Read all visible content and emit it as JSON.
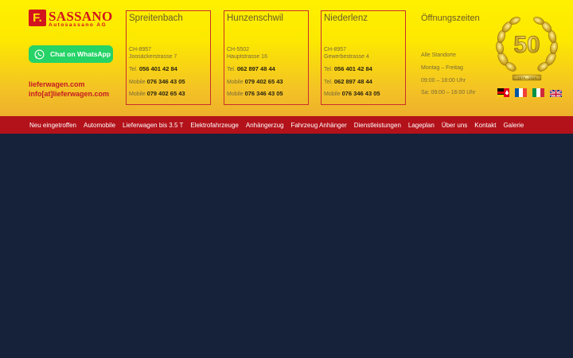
{
  "logo": {
    "box_letter": "F.",
    "name": "SASSANO",
    "sub": "Autosassano AG"
  },
  "whatsapp": {
    "label": "Chat on WhatsApp"
  },
  "links": {
    "website": "lieferwagen.com",
    "email": "info[at]lieferwagen.com"
  },
  "locations": [
    {
      "title": "Spreitenbach",
      "zip": "CH-8957",
      "street": "Joosäckerstrasse 7",
      "rows": [
        {
          "prefix": "Tel.",
          "value": "056 401 42 84"
        },
        {
          "prefix": "Mobile",
          "value": "076 346 43 05"
        },
        {
          "prefix": "Mobile",
          "value": "079 402 65 43"
        }
      ]
    },
    {
      "title": "Hunzenschwil",
      "zip": "CH-5502",
      "street": "Hauptstrasse 16",
      "rows": [
        {
          "prefix": "Tel.",
          "value": "062 897 48 44"
        },
        {
          "prefix": "Mobile",
          "value": "079 402 65 43"
        },
        {
          "prefix": "Mobile",
          "value": "076 346 43 05"
        }
      ]
    },
    {
      "title": "Niederlenz",
      "zip": "CH-8957",
      "street": "Gewerbestrasse 4",
      "rows": [
        {
          "prefix": "Tel.",
          "value": "056 401 42 84"
        },
        {
          "prefix": "Tel.",
          "value": "062 897 48 44"
        },
        {
          "prefix": "Mobile",
          "value": "076 346 43 05"
        }
      ]
    }
  ],
  "hours": {
    "title": "Öffnungszeiten",
    "lines": [
      "Alle Standorte",
      "Montag – Freitag",
      "09:00 – 18:00 Uhr",
      "Sa: 09:00 – 16:00 Uhr"
    ]
  },
  "badge": {
    "number": "50",
    "years": "1974 - 2024"
  },
  "flags": [
    "flag-de-ch",
    "flag-fr",
    "flag-it",
    "flag-gb"
  ],
  "nav": [
    "Neu eingetroffen",
    "Automobile",
    "Lieferwagen bis 3.5 T",
    "Elektrofahrzeuge",
    "Anhängerzug",
    "Fahrzeug Anhänger",
    "Dienstleistungen",
    "Lageplan",
    "Über uns",
    "Kontakt",
    "Galerie"
  ],
  "colors": {
    "brand_red": "#d2141e",
    "nav_red": "#b3121a",
    "whatsapp_green": "#25d366",
    "page_bg": "#16213a"
  }
}
